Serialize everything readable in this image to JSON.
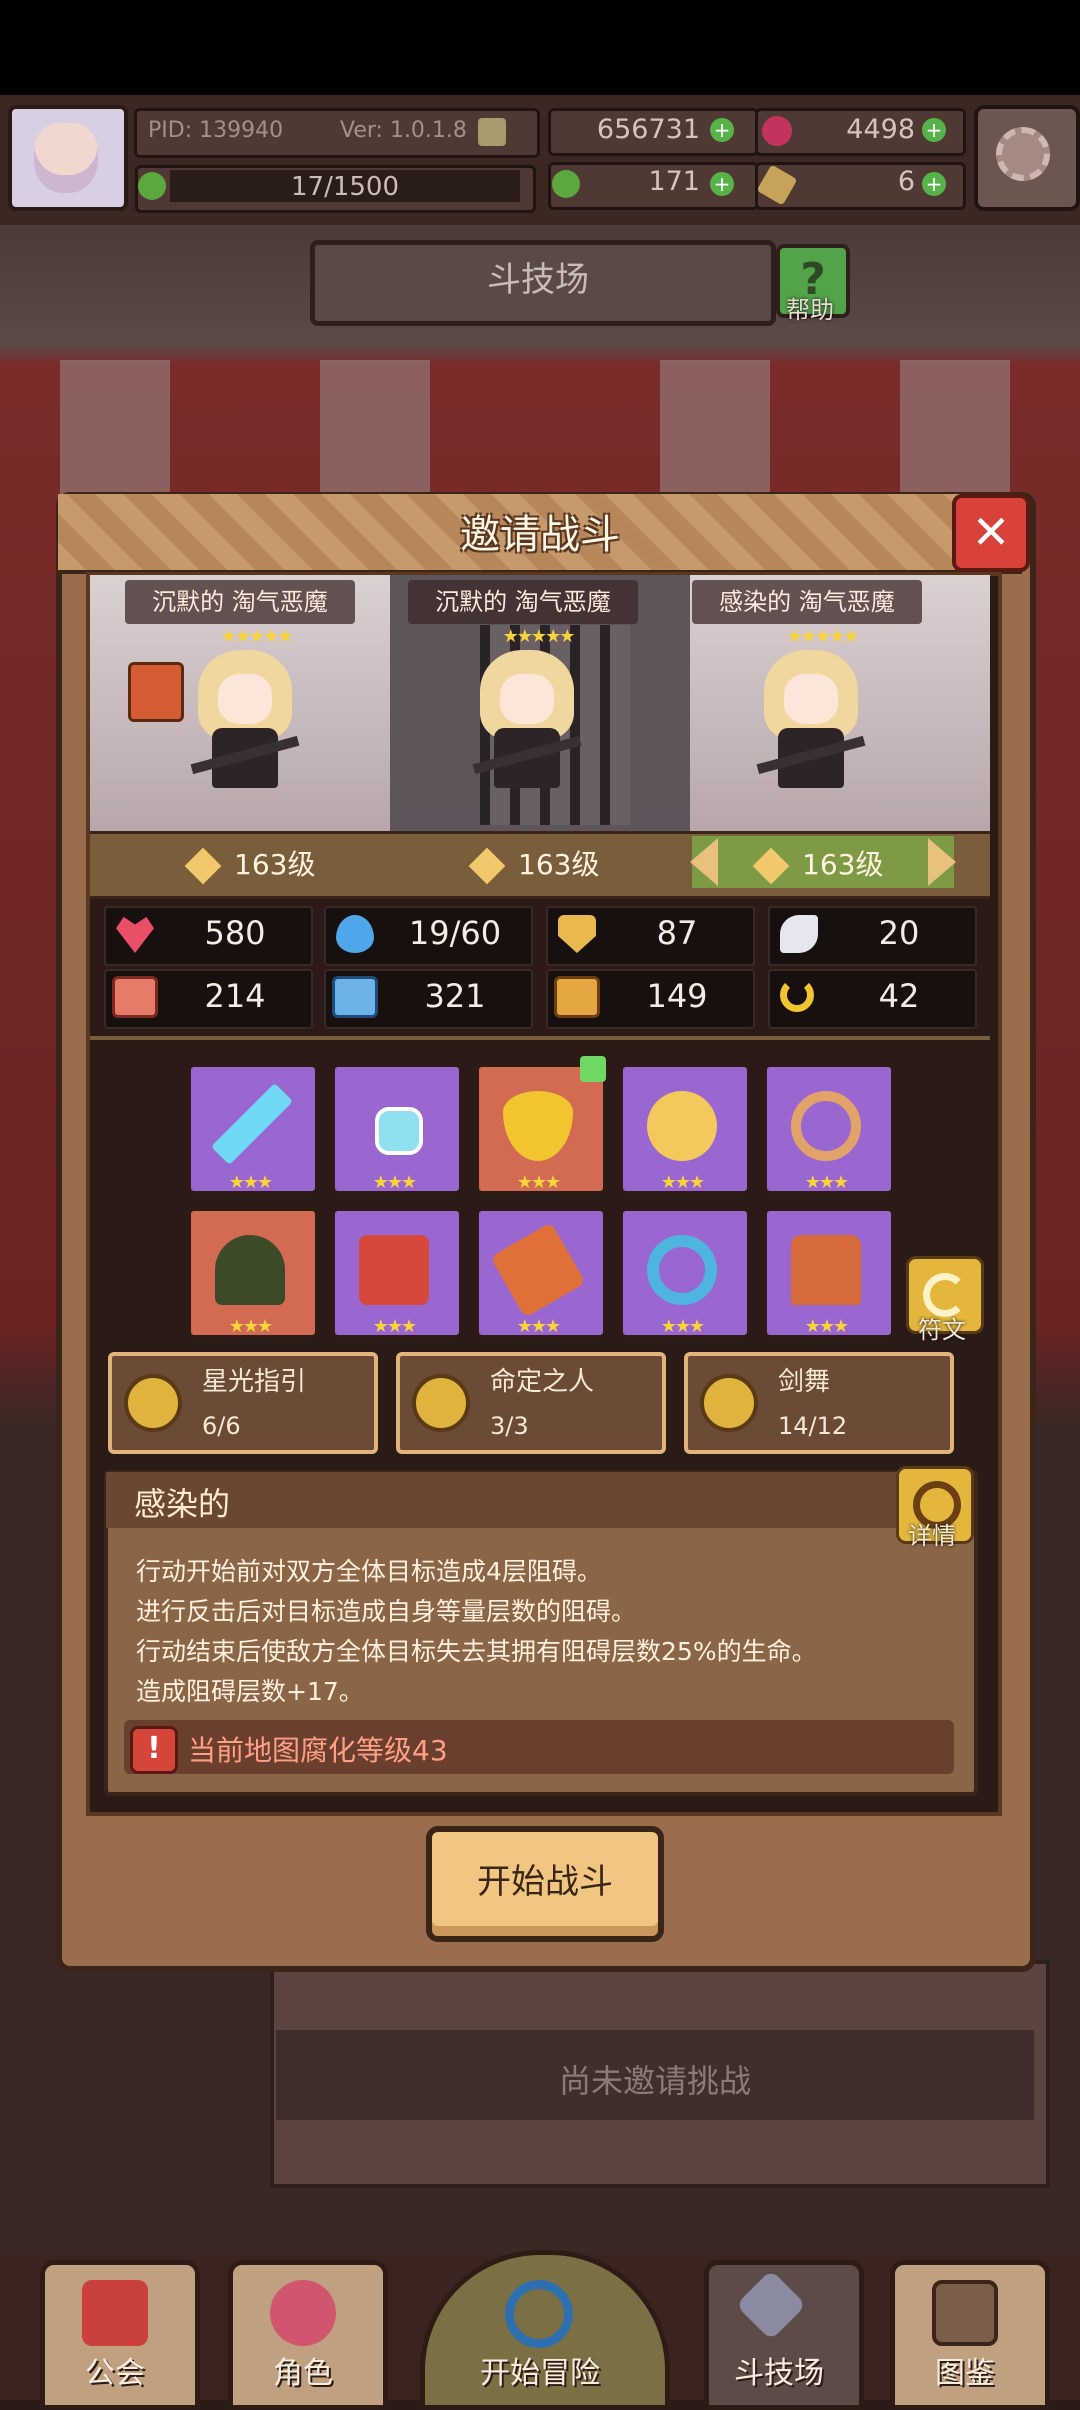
{
  "header": {
    "pid": "PID: 139940",
    "version": "Ver: 1.0.1.8",
    "gold": "656731",
    "gems": "4498",
    "chips": "17/1500",
    "clover": "171",
    "keys": "6"
  },
  "page": {
    "title": "斗技场",
    "help": "帮助"
  },
  "modal": {
    "title": "邀请战斗",
    "opponents": [
      {
        "name": "沉默的 淘气恶魔",
        "stars": "★★★★★",
        "level": "163级"
      },
      {
        "name": "沉默的 淘气恶魔",
        "stars": "★★★★★",
        "level": "163级"
      },
      {
        "name": "感染的 淘气恶魔",
        "stars": "★★★★★",
        "level": "163级"
      }
    ],
    "stats": {
      "hp": "580",
      "mana": "19/60",
      "defense": "87",
      "speed": "20",
      "attack": "214",
      "magic": "321",
      "armor": "149",
      "luck": "42"
    },
    "item_stars": "★★★",
    "rune_label": "符文",
    "sets": [
      {
        "name": "星光指引",
        "count": "6/6"
      },
      {
        "name": "命定之人",
        "count": "3/3"
      },
      {
        "name": "剑舞",
        "count": "14/12"
      }
    ],
    "affix": {
      "title": "感染的",
      "detail_label": "详情",
      "lines": [
        "行动开始前对双方全体目标造成4层阻碍。",
        "进行反击后对目标造成自身等量层数的阻碍。",
        "行动结束后使敌方全体目标失去其拥有阻碍层数25%的生命。",
        "造成阻碍层数+17。"
      ],
      "warning": "当前地图腐化等级43"
    },
    "start_button": "开始战斗"
  },
  "arena": {
    "status": "尚未邀请挑战"
  },
  "nav": [
    "公会",
    "角色",
    "开始冒险",
    "斗技场",
    "图鉴"
  ],
  "colors": {
    "accent_gold": "#f0c680",
    "warning_red": "#d6453a",
    "item_purple": "#9a66d0",
    "item_red": "#d36b52",
    "star_yellow": "#f7d43a"
  }
}
